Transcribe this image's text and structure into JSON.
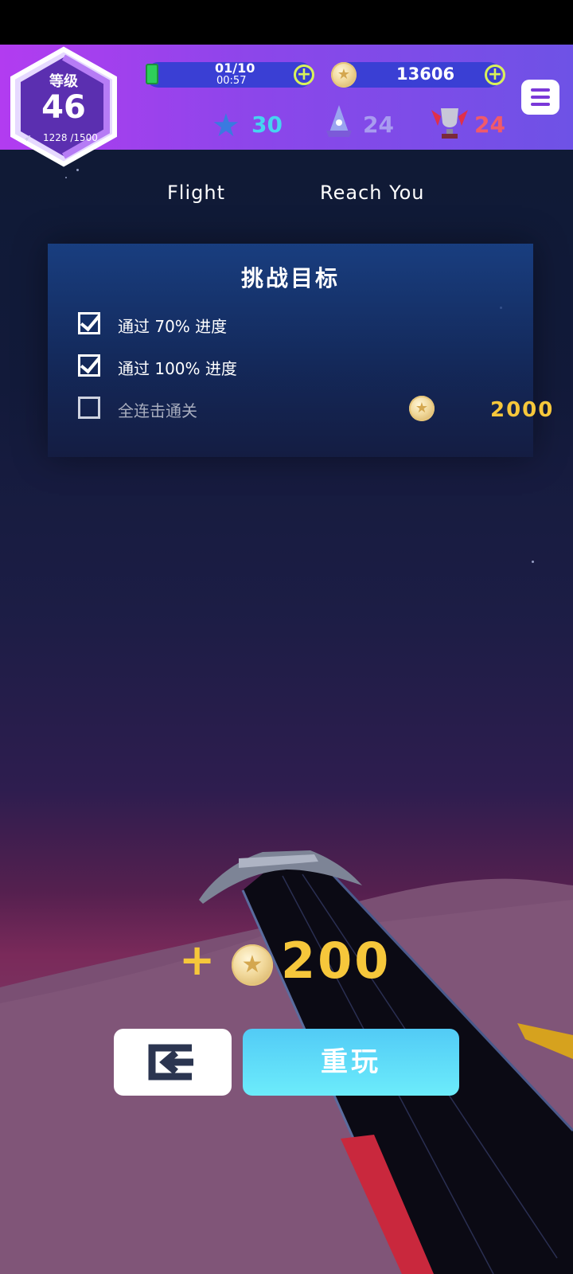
{
  "level": {
    "label": "等级",
    "value": "46",
    "xp": "1228 /1500",
    "xp_progress": 0.819
  },
  "energy": {
    "count": "01/10",
    "timer": "00:57"
  },
  "coins": {
    "value": "13606"
  },
  "stats": [
    {
      "icon": "blue-star-icon",
      "value": "30",
      "color": "#46d4f0"
    },
    {
      "icon": "crown-icon",
      "value": "24",
      "color": "#a99cf0"
    },
    {
      "icon": "trophy-icon",
      "value": "24",
      "color": "#f05a6a"
    }
  ],
  "songs": {
    "left": "Flight",
    "center": "Reach You"
  },
  "challenge": {
    "title": "挑战目标",
    "goals": [
      {
        "label": "通过 70% 进度",
        "done": true
      },
      {
        "label": "通过 100% 进度",
        "done": true
      },
      {
        "label": "全连击通关",
        "done": false
      }
    ],
    "reward": "2000"
  },
  "gain": {
    "plus": "+",
    "value": "200"
  },
  "buttons": {
    "replay": "重玩"
  },
  "colors": {
    "gold": "#f6c73b",
    "header": "#8c46ea",
    "accent": "#d9f25a",
    "replay": "#5fdcf8"
  }
}
